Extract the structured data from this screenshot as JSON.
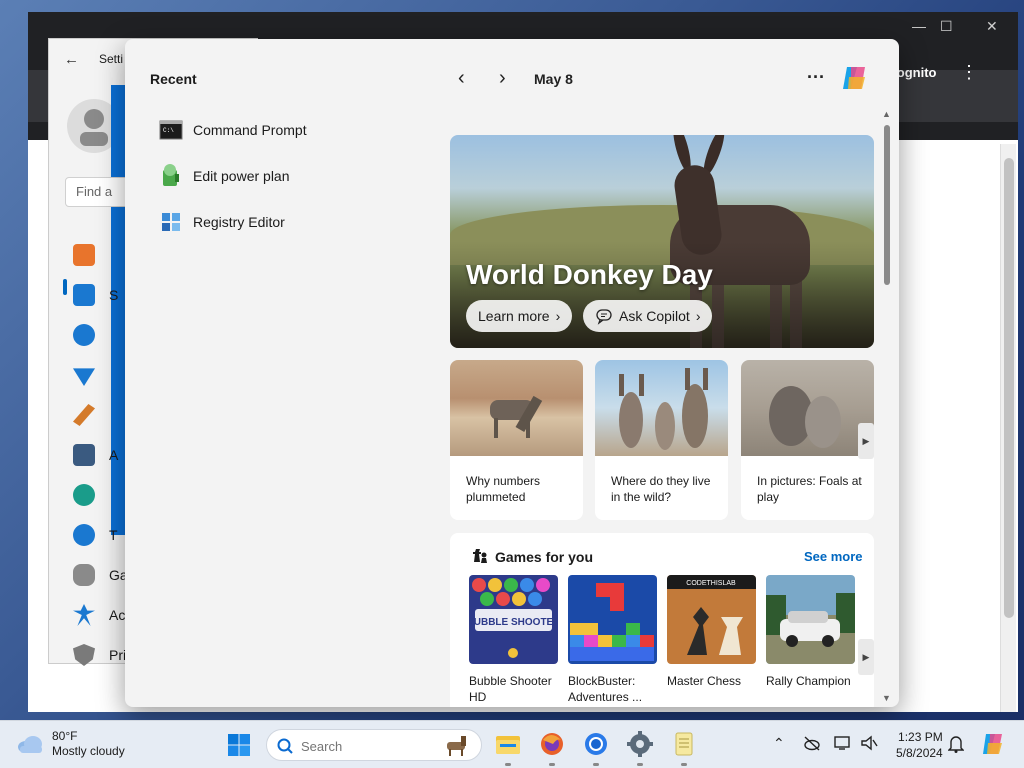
{
  "browser": {
    "incognito_label": "Incognito",
    "menu_icon": "more-vert-icon"
  },
  "settings": {
    "title": "Setti",
    "search_placeholder": "Find a",
    "nav_items": [
      {
        "label": "",
        "icon": "home-icon"
      },
      {
        "label": "S",
        "icon": "system-icon"
      },
      {
        "label": "",
        "icon": "bluetooth-icon"
      },
      {
        "label": "",
        "icon": "wifi-icon"
      },
      {
        "label": "",
        "icon": "brush-icon"
      },
      {
        "label": "A",
        "icon": "apps-icon"
      },
      {
        "label": "",
        "icon": "account-icon"
      },
      {
        "label": "T",
        "icon": "time-icon"
      },
      {
        "label": "Ga",
        "icon": "gaming-icon"
      },
      {
        "label": "Ac",
        "icon": "accessibility-icon"
      },
      {
        "label": "Pri",
        "icon": "privacy-icon"
      }
    ]
  },
  "flyout": {
    "recent_title": "Recent",
    "recent_items": [
      {
        "label": "Command Prompt",
        "icon": "command-prompt-icon"
      },
      {
        "label": "Edit power plan",
        "icon": "power-plan-icon"
      },
      {
        "label": "Registry Editor",
        "icon": "registry-editor-icon"
      }
    ],
    "date": "May 8",
    "hero": {
      "title": "World Donkey Day",
      "learn_more": "Learn more",
      "ask_copilot": "Ask Copilot"
    },
    "cards": [
      {
        "caption": "Why numbers plummeted"
      },
      {
        "caption": "Where do they live in the wild?"
      },
      {
        "caption": "In pictures: Foals at play"
      }
    ],
    "games": {
      "title": "Games for you",
      "see_more": "See more",
      "items": [
        {
          "label": "Bubble Shooter HD",
          "thumb_text": "BUBBLE SHOOTER"
        },
        {
          "label": "BlockBuster: Adventures ..."
        },
        {
          "label": "Master Chess",
          "thumb_text": "CODETHISLAB"
        },
        {
          "label": "Rally Champion"
        }
      ]
    }
  },
  "taskbar": {
    "weather_temp": "80°F",
    "weather_condition": "Mostly cloudy",
    "search_placeholder": "Search",
    "time": "1:23 PM",
    "date": "5/8/2024"
  },
  "colors": {
    "accent": "#0067c0",
    "flyout_bg": "#f3f3f3",
    "taskbar_bg": "#e6ecf4"
  }
}
